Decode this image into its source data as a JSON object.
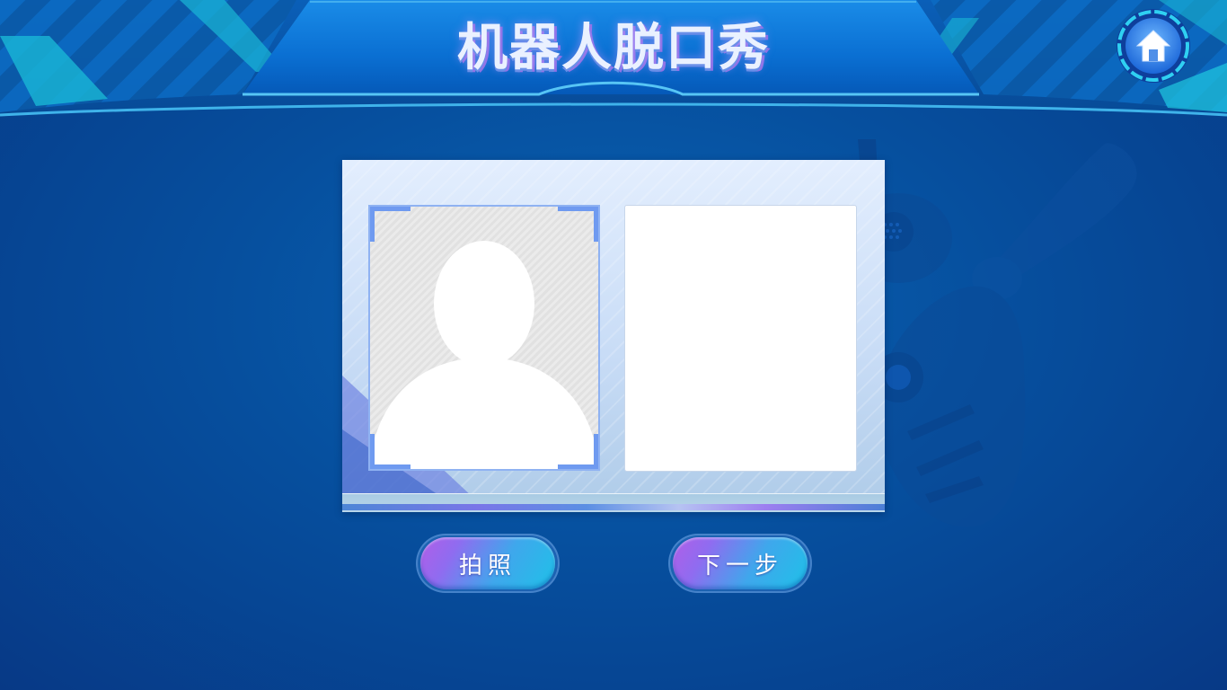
{
  "header": {
    "title": "机器人脱口秀",
    "home_icon": "home-icon"
  },
  "card": {
    "photo_placeholder_icon": "person-silhouette-icon"
  },
  "actions": {
    "photo_label": "拍照",
    "next_label": "下一步"
  },
  "colors": {
    "background": "#0a5aa8",
    "header": "#0a72d6",
    "accent_cyan": "#1fc1e8",
    "accent_purple": "#b15ee8",
    "frame_corner": "#6f9af0"
  }
}
